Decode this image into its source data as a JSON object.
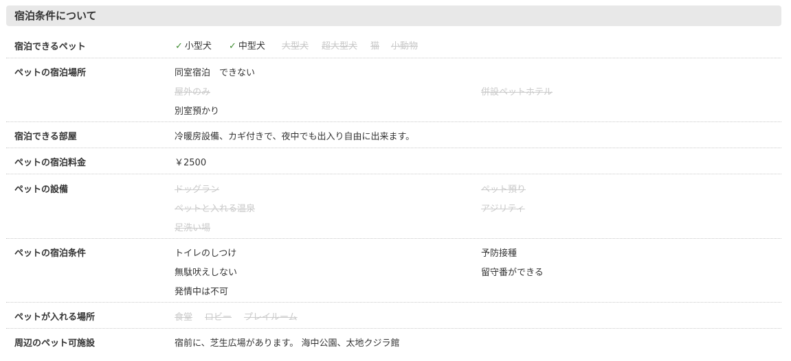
{
  "title": "宿泊条件について",
  "rows": [
    {
      "label": "宿泊できるペット",
      "items": [
        {
          "text": "小型犬",
          "enabled": true
        },
        {
          "text": "中型犬",
          "enabled": true
        },
        {
          "text": "大型犬",
          "enabled": false
        },
        {
          "text": "超大型犬",
          "enabled": false
        },
        {
          "text": "猫",
          "enabled": false
        },
        {
          "text": "小動物",
          "enabled": false
        }
      ]
    },
    {
      "label": "ペットの宿泊場所",
      "items": [
        {
          "text": "同室宿泊　できない",
          "enabled": true
        },
        {
          "text": "屋外のみ",
          "enabled": false
        },
        {
          "text": "併設ペットホテル",
          "enabled": false
        },
        {
          "text": "別室預かり",
          "enabled": true
        }
      ]
    },
    {
      "label": "宿泊できる部屋",
      "items": [
        {
          "text": "冷暖房設備、カギ付きで、夜中でも出入り自由に出来ます。",
          "enabled": true
        }
      ]
    },
    {
      "label": "ペットの宿泊料金",
      "items": [
        {
          "text": "￥2500",
          "enabled": true
        }
      ]
    },
    {
      "label": "ペットの設備",
      "items": [
        {
          "text": "ドッグラン",
          "enabled": false
        },
        {
          "text": "ペット預り",
          "enabled": false
        },
        {
          "text": "ペットと入れる温泉",
          "enabled": false
        },
        {
          "text": "アジリティ",
          "enabled": false
        },
        {
          "text": "足洗い場",
          "enabled": false
        }
      ]
    },
    {
      "label": "ペットの宿泊条件",
      "items": [
        {
          "text": "トイレのしつけ",
          "enabled": true
        },
        {
          "text": "予防接種",
          "enabled": true
        },
        {
          "text": "無駄吠えしない",
          "enabled": true
        },
        {
          "text": "留守番ができる",
          "enabled": true
        },
        {
          "text": "発情中は不可",
          "enabled": true
        }
      ]
    },
    {
      "label": "ペットが入れる場所",
      "items": [
        {
          "text": "食堂",
          "enabled": false
        },
        {
          "text": "ロビー",
          "enabled": false
        },
        {
          "text": "プレイルーム",
          "enabled": false
        }
      ]
    },
    {
      "label": "周辺のペット可施設",
      "items": [
        {
          "text": "宿前に、芝生広場があります。 海中公園、太地クジラ館",
          "enabled": true
        }
      ]
    }
  ],
  "colors": {
    "check": "#3c8a2e",
    "disabled_text": "#c9c9c9",
    "header_bg": "#e8e8e8"
  }
}
